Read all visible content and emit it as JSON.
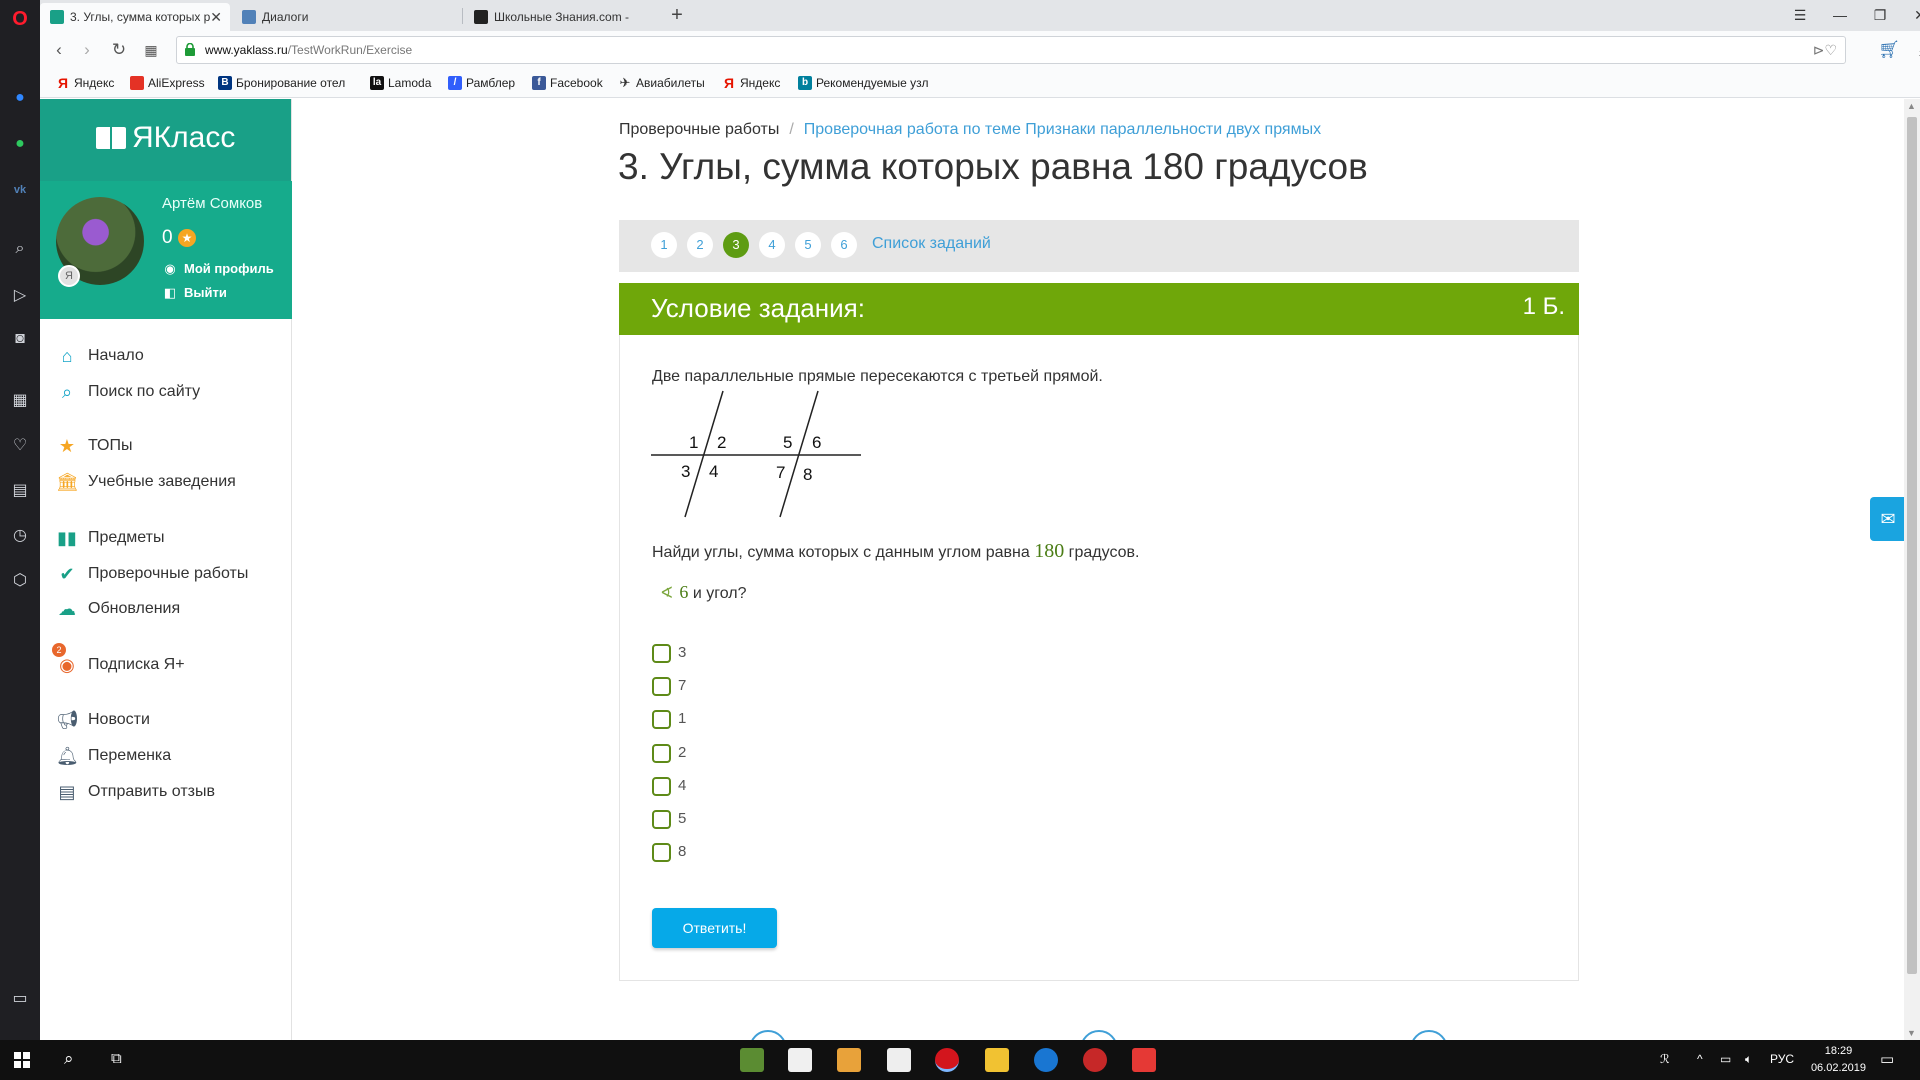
{
  "browser": {
    "tabs": [
      {
        "label": "3. Углы, сумма которых р",
        "active": true
      },
      {
        "label": "Диалоги",
        "active": false
      },
      {
        "label": "Школьные Знания.com -",
        "active": false
      }
    ],
    "new_tab": "+",
    "address": {
      "host": "www.yaklass.ru",
      "path": "/TestWorkRun/Exercise"
    },
    "bookmarks": [
      "Яндекс",
      "AliExpress",
      "Бронирование отел",
      "Lamoda",
      "Рамблер",
      "Facebook",
      "Авиабилеты",
      "Яндекс",
      "Рекомендуемые узл"
    ]
  },
  "sidebar": {
    "logo": "ЯКласс",
    "user": {
      "name": "Артём Сомков",
      "points": "0",
      "profile": "Мой профиль",
      "logout": "Выйти",
      "badge": "Я"
    },
    "menu": [
      {
        "label": "Начало",
        "icon": "home-icon"
      },
      {
        "label": "Поиск по сайту",
        "icon": "search-icon"
      },
      {
        "label": "ТОПы",
        "icon": "star-icon"
      },
      {
        "label": "Учебные заведения",
        "icon": "school-icon"
      },
      {
        "label": "Предметы",
        "icon": "books-icon"
      },
      {
        "label": "Проверочные работы",
        "icon": "check-icon"
      },
      {
        "label": "Обновления",
        "icon": "cloud-icon"
      },
      {
        "label": "Подписка Я+",
        "icon": "subscription-icon"
      },
      {
        "label": "Новости",
        "icon": "megaphone-icon"
      },
      {
        "label": "Переменка",
        "icon": "bell-icon"
      },
      {
        "label": "Отправить отзыв",
        "icon": "feedback-icon"
      }
    ],
    "check_badge": "2"
  },
  "main": {
    "breadcrumb": {
      "root": "Проверочные работы",
      "sep": "/",
      "current": "Проверочная работа по теме Признаки параллельности двух прямых"
    },
    "title": "3. Углы, сумма которых равна 180 градусов",
    "pager": {
      "pages": [
        "1",
        "2",
        "3",
        "4",
        "5",
        "6"
      ],
      "active": "3",
      "list_link": "Список заданий"
    },
    "task": {
      "header": "Условие задания:",
      "score": "1 Б.",
      "text": "Две параллельные прямые пересекаются с третьей прямой.",
      "figure_labels": [
        "1",
        "2",
        "3",
        "4",
        "5",
        "6",
        "7",
        "8"
      ],
      "question_before": "Найди углы, сумма которых с данным углом равна ",
      "question_number": "180",
      "question_after": " градусов.",
      "angle_symbol": "∢",
      "angle_number": "6",
      "angle_suffix": " и угол?",
      "options": [
        "3",
        "7",
        "1",
        "2",
        "4",
        "5",
        "8"
      ],
      "answer_button": "Ответить!"
    }
  },
  "taskbar": {
    "lang": "РУС",
    "time": "18:29",
    "date": "06.02.2019"
  },
  "colors": {
    "teal": "#19a087",
    "green_header": "#6fa70a",
    "link_blue": "#3f9fd7",
    "button_blue": "#06a9e8"
  }
}
